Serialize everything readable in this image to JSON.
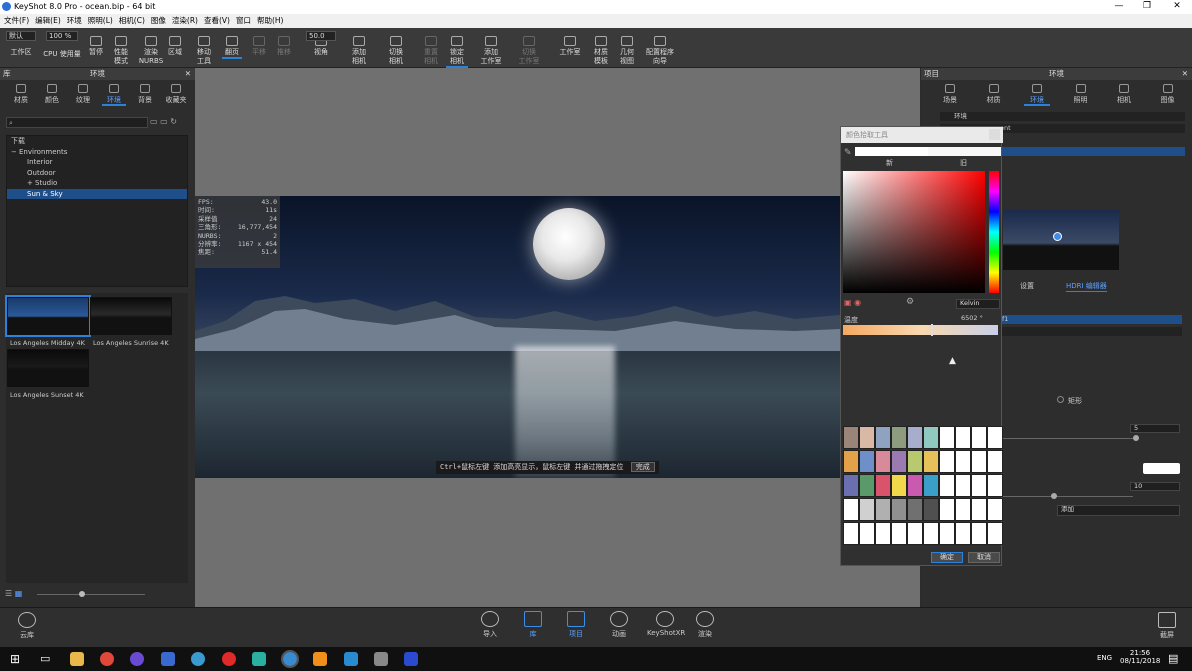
{
  "titlebar": {
    "title": "KeyShot 8.0 Pro - ocean.bip - 64 bit",
    "min": "—",
    "max": "❐",
    "close": "✕"
  },
  "menu": [
    "文件(F)",
    "编辑(E)",
    "环境",
    "照明(L)",
    "相机(C)",
    "图像",
    "渲染(R)",
    "查看(V)",
    "窗口",
    "帮助(H)"
  ],
  "toolbar": {
    "preset": "默认",
    "zoom": "100 %",
    "cpu": "CPU 使用量",
    "items": [
      {
        "label": "工作区",
        "dim": false,
        "sel": false
      },
      {
        "label": "暂停",
        "dim": false,
        "sel": false
      },
      {
        "label": "性能\n模式",
        "dim": false,
        "sel": false
      },
      {
        "label": "渲染\nNURBS",
        "dim": false,
        "sel": false
      },
      {
        "label": "区域",
        "dim": false,
        "sel": false
      },
      {
        "label": "移动\n工具",
        "dim": false,
        "sel": false
      },
      {
        "label": "翻页",
        "dim": false,
        "sel": true
      },
      {
        "label": "平移",
        "dim": true,
        "sel": false
      },
      {
        "label": "推移",
        "dim": true,
        "sel": false
      },
      {
        "label": "视角",
        "dim": false,
        "sel": false
      },
      {
        "label": "添加\n相机",
        "dim": false,
        "sel": false
      },
      {
        "label": "切换\n相机",
        "dim": false,
        "sel": false
      },
      {
        "label": "重置\n相机",
        "dim": true,
        "sel": false
      },
      {
        "label": "锁定\n相机",
        "dim": false,
        "sel": true
      },
      {
        "label": "添加\n工作室",
        "dim": false,
        "sel": false
      },
      {
        "label": "切换\n工作室",
        "dim": true,
        "sel": false
      },
      {
        "label": "工作室",
        "dim": false,
        "sel": false
      },
      {
        "label": "材质\n模板",
        "dim": false,
        "sel": false
      },
      {
        "label": "几何\n视图",
        "dim": false,
        "sel": false
      },
      {
        "label": "配置程序\n向导",
        "dim": false,
        "sel": false
      }
    ],
    "fov": "50.0"
  },
  "left": {
    "header": "环境",
    "side_label": "库",
    "tabs": [
      "材质",
      "颜色",
      "纹理",
      "环境",
      "背景",
      "收藏夹"
    ],
    "selected_tab": "环境",
    "tree": [
      {
        "label": "下载",
        "indent": 0,
        "sel": false
      },
      {
        "label": "Environments",
        "indent": 0,
        "sel": false,
        "prefix": "−"
      },
      {
        "label": "Interior",
        "indent": 1,
        "sel": false
      },
      {
        "label": "Outdoor",
        "indent": 1,
        "sel": false
      },
      {
        "label": "Studio",
        "indent": 1,
        "sel": false,
        "prefix": "+"
      },
      {
        "label": "Sun & Sky",
        "indent": 1,
        "sel": true
      }
    ],
    "thumbs": [
      {
        "label": "Los Angeles Midday 4K",
        "sel": true
      },
      {
        "label": "Los Angeles Sunrise 4K",
        "sel": false
      },
      {
        "label": "Los Angeles Sunset 4K",
        "sel": false
      }
    ]
  },
  "viewport": {
    "stats": [
      [
        "FPS:",
        "43.0"
      ],
      [
        "时间:",
        "11s"
      ],
      [
        "采样值",
        "24"
      ],
      [
        "三角形:",
        "16,777,454"
      ],
      [
        "NURBS:",
        "2"
      ],
      [
        "分辨率:",
        "1167 x 454"
      ],
      [
        "焦距:",
        "51.4"
      ]
    ],
    "hint": "Ctrl+鼠标左键 添加高亮显示，鼠标左键 并通过拖拽定位",
    "hint_done": "完成"
  },
  "right": {
    "header": "环境",
    "side_label": "项目",
    "tabs": [
      "场景",
      "材质",
      "环境",
      "照明",
      "相机",
      "图像"
    ],
    "selected_tab": "环境",
    "list": [
      "环境",
      "ent",
      ""
    ],
    "subtabs": [
      "设置",
      "HDRI 编辑器"
    ],
    "rect_label": "矩形",
    "field1": "5",
    "field2": "10",
    "add_label": "添加",
    "sel_item": "f1"
  },
  "colorpicker": {
    "title": "颜色拾取工具",
    "new_label": "新",
    "old_label": "旧",
    "mode": "Kelvin",
    "temp_label": "温度",
    "temp_value": "6502 °",
    "ok": "确定",
    "cancel": "取消",
    "swatches": [
      "#9a8578",
      "#d9b8a6",
      "#8fa3c0",
      "#8f9b7e",
      "#a7aecb",
      "#8fc9c0",
      "#ffffff",
      "#ffffff",
      "#ffffff",
      "#ffffff",
      "#e3a24a",
      "#6f8fc9",
      "#d98a9a",
      "#9a7ab0",
      "#b9c96e",
      "#e6c15a",
      "#ffffff",
      "#ffffff",
      "#ffffff",
      "#ffffff",
      "#6a6fb0",
      "#5a9a6a",
      "#d9546a",
      "#f0d84a",
      "#c95ab0",
      "#3aa0c9",
      "#ffffff",
      "#ffffff",
      "#ffffff",
      "#ffffff",
      "#ffffff",
      "#d0d0d0",
      "#b0b0b0",
      "#909090",
      "#707070",
      "#505050",
      "#ffffff",
      "#ffffff",
      "#ffffff",
      "#ffffff",
      "#ffffff",
      "#ffffff",
      "#ffffff",
      "#ffffff",
      "#ffffff",
      "#ffffff",
      "#ffffff",
      "#ffffff",
      "#ffffff",
      "#ffffff"
    ]
  },
  "bottombar": {
    "cloud": "云库",
    "full": "截屏",
    "items": [
      {
        "label": "导入",
        "sel": false
      },
      {
        "label": "库",
        "sel": true
      },
      {
        "label": "项目",
        "sel": true
      },
      {
        "label": "动画",
        "sel": false
      },
      {
        "label": "KeyShotXR",
        "sel": false
      },
      {
        "label": "渲染",
        "sel": false
      }
    ]
  },
  "taskbar": {
    "time": "21:56",
    "date": "08/11/2018",
    "lang": "ENG"
  }
}
